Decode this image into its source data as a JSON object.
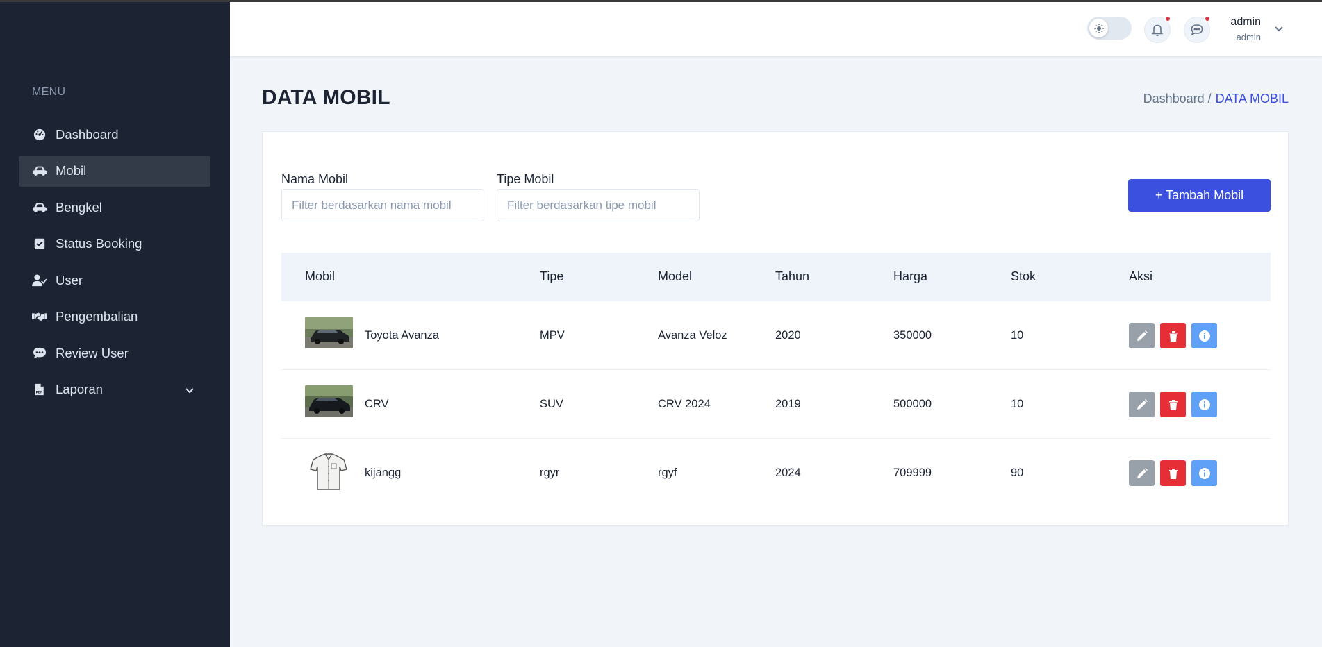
{
  "sidebar": {
    "menu_heading": "MENU",
    "items": [
      {
        "label": "Dashboard",
        "icon": "dashboard-icon"
      },
      {
        "label": "Mobil",
        "icon": "car-icon",
        "active": true
      },
      {
        "label": "Bengkel",
        "icon": "car-icon"
      },
      {
        "label": "Status Booking",
        "icon": "check-square-icon"
      },
      {
        "label": "User",
        "icon": "user-check-icon"
      },
      {
        "label": "Pengembalian",
        "icon": "handshake-icon"
      },
      {
        "label": "Review User",
        "icon": "comment-dots-icon"
      },
      {
        "label": "Laporan",
        "icon": "file-pdf-icon",
        "has_submenu": true
      }
    ]
  },
  "header": {
    "theme_toggle_icon": "sun-icon",
    "notifications_icon": "bell-icon",
    "messages_icon": "chat-icon",
    "user_name": "admin",
    "user_role": "admin"
  },
  "page": {
    "title": "DATA MOBIL",
    "breadcrumb_parent": "Dashboard /",
    "breadcrumb_current": "DATA MOBIL"
  },
  "filters": {
    "name_label": "Nama Mobil",
    "name_placeholder": "Filter berdasarkan nama mobil",
    "name_value": "",
    "type_label": "Tipe Mobil",
    "type_placeholder": "Filter berdasarkan tipe mobil",
    "type_value": ""
  },
  "add_button_label": "+ Tambah Mobil",
  "table": {
    "columns": [
      "Mobil",
      "Tipe",
      "Model",
      "Tahun",
      "Harga",
      "Stok",
      "Aksi"
    ],
    "rows": [
      {
        "name": "Toyota Avanza",
        "image": "car-photo",
        "tipe": "MPV",
        "model": "Avanza Veloz",
        "tahun": "2020",
        "harga": "350000",
        "stok": "10"
      },
      {
        "name": "CRV",
        "image": "car-photo",
        "tipe": "SUV",
        "model": "CRV 2024",
        "tahun": "2019",
        "harga": "500000",
        "stok": "10"
      },
      {
        "name": "kijangg",
        "image": "shirt-image",
        "tipe": "rgyr",
        "model": "rgyf",
        "tahun": "2024",
        "harga": "709999",
        "stok": "90"
      }
    ]
  },
  "colors": {
    "sidebar_bg": "#1c2434",
    "primary": "#3c50e0",
    "edit": "#98a0aa",
    "delete": "#e62e37",
    "info": "#5fa1f7"
  }
}
